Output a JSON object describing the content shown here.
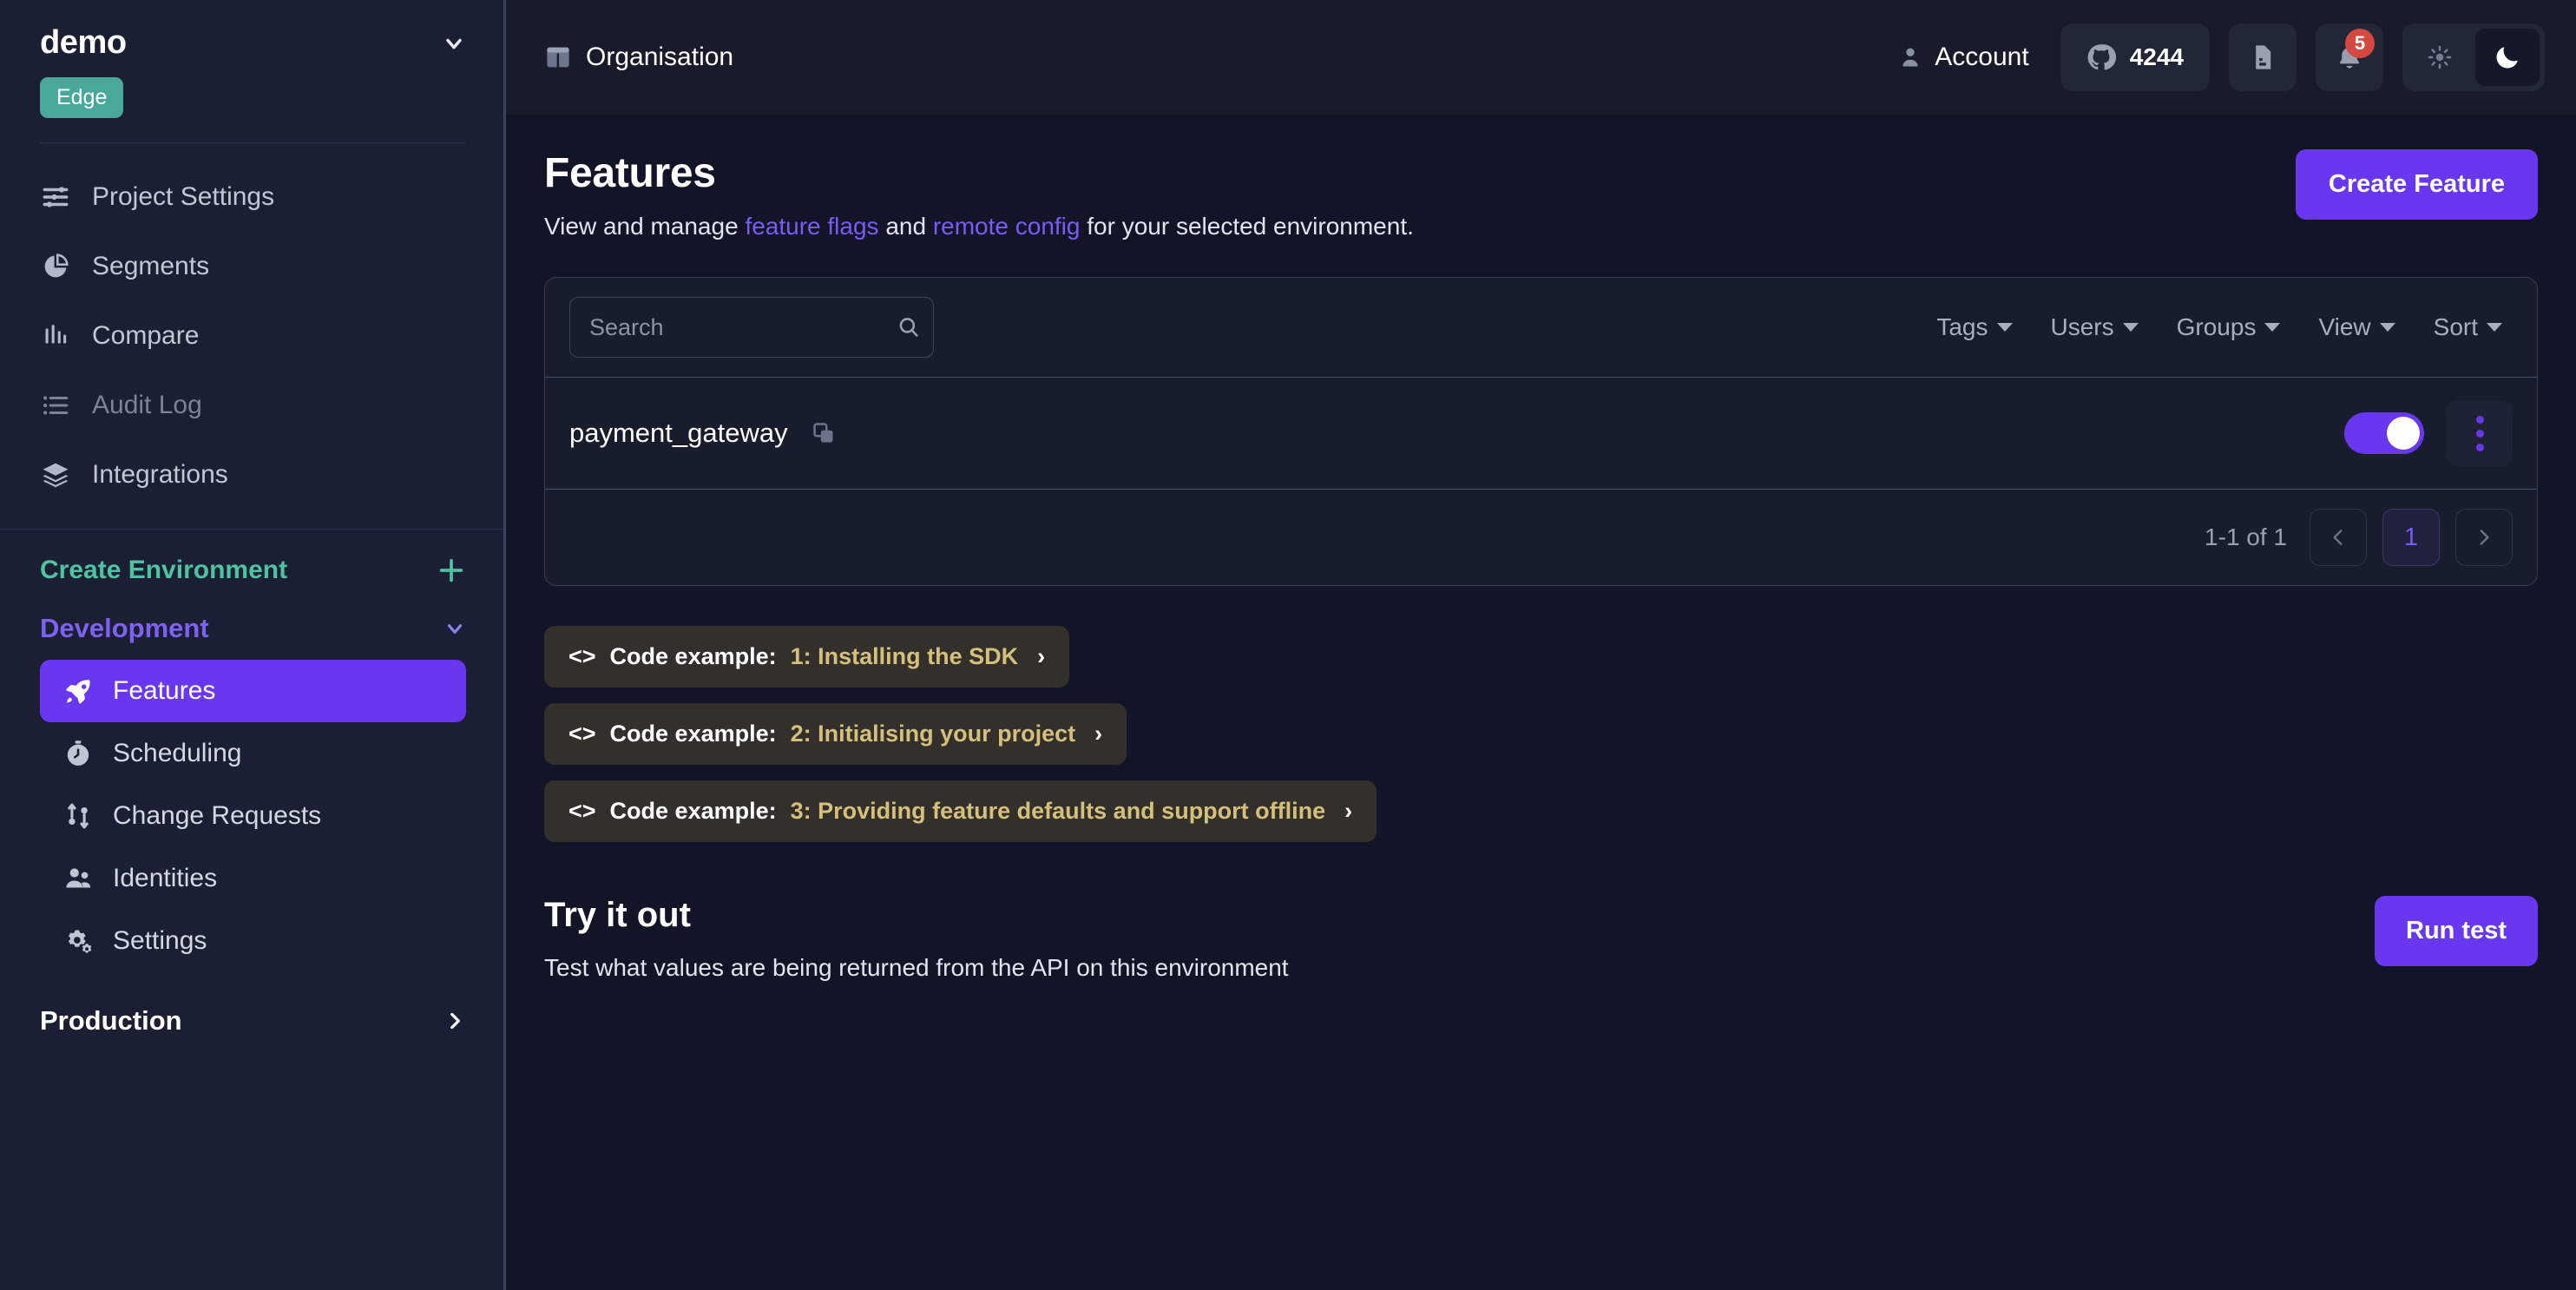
{
  "sidebar": {
    "project_name": "demo",
    "project_chevron_icon": "chevron-down-icon",
    "edge_badge": "Edge",
    "nav_items": [
      {
        "label": "Project Settings",
        "icon": "sliders-icon",
        "dim": false
      },
      {
        "label": "Segments",
        "icon": "pie-chart-icon",
        "dim": false
      },
      {
        "label": "Compare",
        "icon": "bar-chart-icon",
        "dim": false
      },
      {
        "label": "Audit Log",
        "icon": "list-icon",
        "dim": true
      },
      {
        "label": "Integrations",
        "icon": "layers-icon",
        "dim": false
      }
    ],
    "create_environment": {
      "label": "Create Environment",
      "icon": "plus-icon"
    },
    "environments": [
      {
        "name": "Development",
        "expanded": true,
        "chevron_icon": "chevron-down-icon",
        "items": [
          {
            "label": "Features",
            "icon": "rocket-icon",
            "active": true
          },
          {
            "label": "Scheduling",
            "icon": "stopwatch-icon",
            "active": false
          },
          {
            "label": "Change Requests",
            "icon": "git-branch-icon",
            "active": false
          },
          {
            "label": "Identities",
            "icon": "users-icon",
            "active": false
          },
          {
            "label": "Settings",
            "icon": "gears-icon",
            "active": false
          }
        ]
      },
      {
        "name": "Production",
        "expanded": false,
        "chevron_icon": "chevron-right-icon",
        "items": []
      }
    ]
  },
  "topbar": {
    "org_label": "Organisation",
    "org_icon": "layout-icon",
    "account_label": "Account",
    "account_icon": "user-icon",
    "github": {
      "icon": "github-icon",
      "count": "4244"
    },
    "docs_icon": "document-icon",
    "notifications": {
      "icon": "bell-icon",
      "badge": "5"
    },
    "theme": {
      "light_icon": "sun-icon",
      "dark_icon": "moon-icon",
      "selected": "dark"
    }
  },
  "page": {
    "title": "Features",
    "subtitle_prefix": "View and manage ",
    "subtitle_link1": "feature flags",
    "subtitle_mid": " and ",
    "subtitle_link2": "remote config",
    "subtitle_suffix": " for your selected environment.",
    "create_feature_button": "Create Feature"
  },
  "panel": {
    "search_placeholder": "Search",
    "search_value": "",
    "search_icon": "search-icon",
    "filters": [
      {
        "label": "Tags"
      },
      {
        "label": "Users"
      },
      {
        "label": "Groups"
      },
      {
        "label": "View"
      },
      {
        "label": "Sort"
      }
    ],
    "rows": [
      {
        "name": "payment_gateway",
        "copy_icon": "copy-icon",
        "enabled": true,
        "kebab_icon": "more-vertical-icon"
      }
    ],
    "pagination": {
      "count_label": "1-1 of 1",
      "prev_icon": "chevron-left-icon",
      "next_icon": "chevron-right-icon",
      "pages": [
        "1"
      ],
      "current_page": "1"
    }
  },
  "code_examples": [
    {
      "code_icon": "<>",
      "label": "Code example:",
      "title": "1: Installing the SDK",
      "arrow": "›"
    },
    {
      "code_icon": "<>",
      "label": "Code example:",
      "title": "2: Initialising your project",
      "arrow": "›"
    },
    {
      "code_icon": "<>",
      "label": "Code example:",
      "title": "3: Providing feature defaults and support offline",
      "arrow": "›"
    }
  ],
  "tryout": {
    "title": "Try it out",
    "description": "Test what values are being returned from the API on this environment",
    "run_button": "Run test"
  },
  "colors": {
    "accent_purple": "#6837ef",
    "link_purple": "#7a5cf5",
    "edge_teal": "#4aa89a",
    "create_env_green": "#4fc3a1",
    "code_gold": "#d4c07a",
    "badge_red": "#d4493f",
    "sidebar_bg": "#1a1f33",
    "main_bg": "#111527",
    "topbar_bg": "#171b2a",
    "panel_bg": "#181d2e"
  }
}
